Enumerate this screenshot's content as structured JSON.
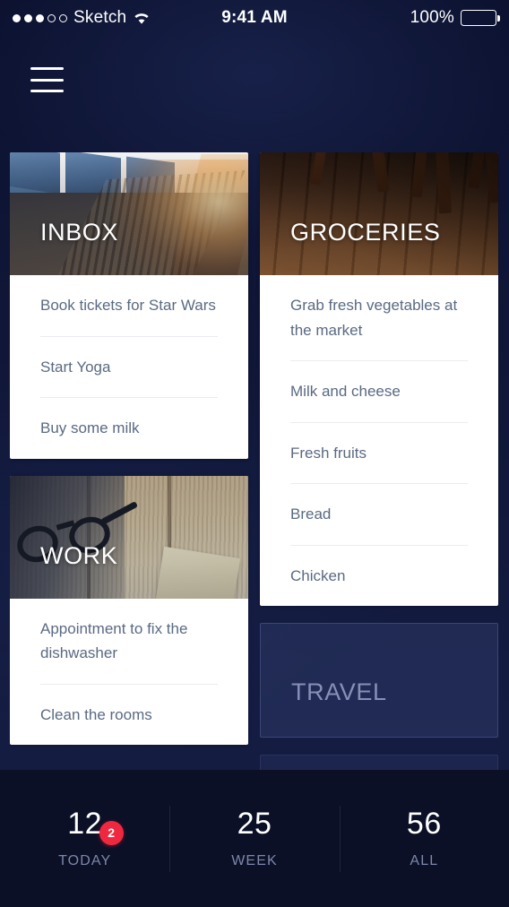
{
  "status_bar": {
    "signal_filled": 3,
    "signal_empty": 2,
    "carrier": "Sketch",
    "wifi_icon": "wifi-icon",
    "time": "9:41 AM",
    "battery_percent": "100%",
    "battery_icon": "battery-full-icon"
  },
  "header": {
    "menu_icon": "hamburger-menu-icon"
  },
  "board": {
    "columns": [
      {
        "cards": [
          {
            "id": "inbox",
            "title": "INBOX",
            "kind": "list",
            "hero": "train-platform-photo",
            "items": [
              "Book tickets for Star Wars",
              "Start Yoga",
              "Buy some milk"
            ]
          },
          {
            "id": "work",
            "title": "WORK",
            "kind": "list",
            "hero": "wooden-desk-glasses-photo",
            "items": [
              "Appointment to fix the dishwasher",
              "Clean the rooms"
            ]
          }
        ]
      },
      {
        "cards": [
          {
            "id": "groceries",
            "title": "GROCERIES",
            "kind": "list",
            "hero": "wooden-floor-chairs-photo",
            "items": [
              "Grab fresh vegetables at the market",
              "Milk and cheese",
              "Fresh fruits",
              "Bread",
              "Chicken"
            ]
          },
          {
            "id": "travel",
            "title": "TRAVEL",
            "kind": "placeholder",
            "items": []
          }
        ]
      }
    ]
  },
  "bottom_bar": {
    "stats": [
      {
        "value": "12",
        "label": "TODAY",
        "badge": "2"
      },
      {
        "value": "25",
        "label": "WEEK",
        "badge": null
      },
      {
        "value": "56",
        "label": "ALL",
        "badge": null
      }
    ]
  },
  "colors": {
    "background": "#0d1330",
    "bottom_bar": "#0b1026",
    "card": "#ffffff",
    "list_text": "#5a6a82",
    "badge": "#f0283f",
    "stat_label": "#7d87ab",
    "placeholder_text": "#868fb5"
  }
}
